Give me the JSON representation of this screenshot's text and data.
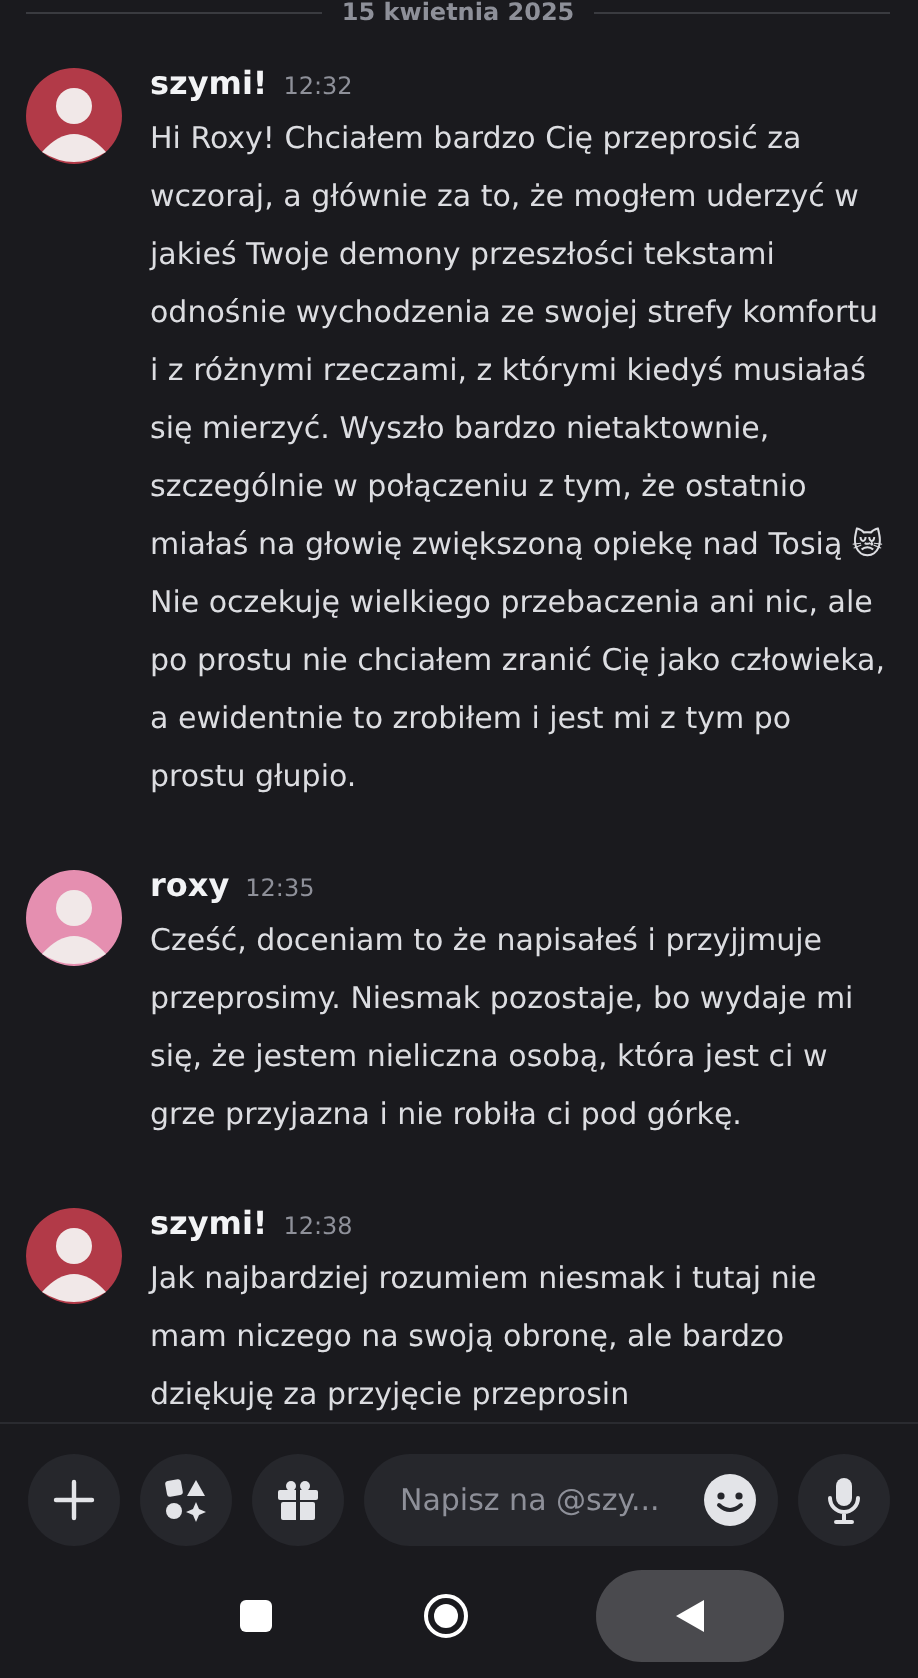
{
  "date_divider": "15 kwietnia 2025",
  "messages": [
    {
      "author": "szymi!",
      "time": "12:32",
      "color": "#b23a48",
      "text": "Hi Roxy! Chciałem bardzo Cię przeprosić za wczoraj, a głównie za to, że mogłem uderzyć w jakieś Twoje demony przeszłości tekstami odnośnie wychodzenia ze swojej strefy komfortu i z różnymi rzeczami, z którymi kiedyś musiałaś się mierzyć. Wyszło bardzo nietaktownie, szczególnie w połączeniu z tym, że ostatnio miałaś na głowię zwiększoną opiekę nad Tosią 😿 Nie oczekuję wielkiego przebaczenia ani nic, ale po prostu nie chciałem zranić Cię jako człowieka, a ewidentnie to zrobiłem i jest mi z tym po prostu głupio."
    },
    {
      "author": "roxy",
      "time": "12:35",
      "color": "#e58fb0",
      "text": "Cześć, doceniam to że napisałeś i przyjjmuje przeprosimy. Niesmak pozostaje, bo wydaje mi się, że jestem nieliczna osobą, która jest ci w grze przyjazna i nie robiła ci pod górkę."
    },
    {
      "author": "szymi!",
      "time": "12:38",
      "color": "#b23a48",
      "text": "Jak najbardziej rozumiem niesmak i tutaj nie mam niczego na swoją obronę, ale bardzo dziękuję za przyjęcie przeprosin"
    }
  ],
  "composer": {
    "placeholder": "Napisz na @szy..."
  }
}
